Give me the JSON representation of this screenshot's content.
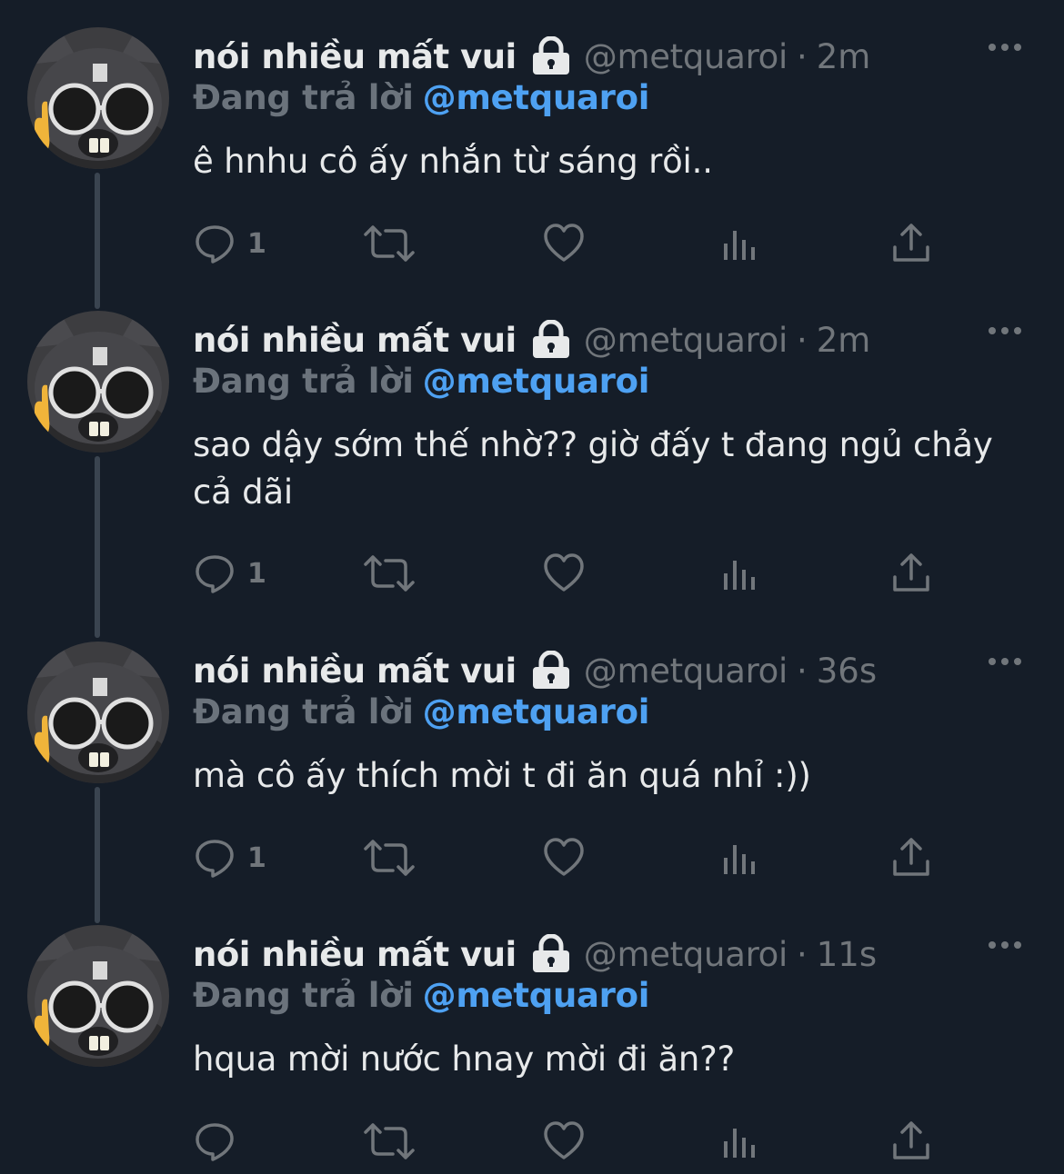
{
  "colors": {
    "background": "#151d28",
    "text_primary": "#e7e9ea",
    "text_secondary": "#71767b",
    "mention": "#4ea1f2",
    "thread_line": "#3a4450"
  },
  "tweets": [
    {
      "name": "nói nhiều mất vui",
      "handle": "@metquaroi",
      "dot": "·",
      "time": "2m",
      "replying_label": "Đang trả lời",
      "replying_to": "@metquaroi",
      "text": "ê hnhu cô ấy nhắn từ sáng rồi..",
      "reply_count": "1",
      "icons": [
        "lock-icon",
        "more-icon",
        "reply-icon",
        "retweet-icon",
        "like-icon",
        "views-icon",
        "share-icon"
      ]
    },
    {
      "name": "nói nhiều mất vui",
      "handle": "@metquaroi",
      "dot": "·",
      "time": "2m",
      "replying_label": "Đang trả lời",
      "replying_to": "@metquaroi",
      "text": "sao dậy sớm thế nhờ?? giờ đấy t đang ngủ chảy cả dãi",
      "reply_count": "1",
      "icons": [
        "lock-icon",
        "more-icon",
        "reply-icon",
        "retweet-icon",
        "like-icon",
        "views-icon",
        "share-icon"
      ]
    },
    {
      "name": "nói nhiều mất vui",
      "handle": "@metquaroi",
      "dot": "·",
      "time": "36s",
      "replying_label": "Đang trả lời",
      "replying_to": "@metquaroi",
      "text": "mà cô ấy thích mời t đi ăn quá nhỉ :))",
      "reply_count": "1",
      "icons": [
        "lock-icon",
        "more-icon",
        "reply-icon",
        "retweet-icon",
        "like-icon",
        "views-icon",
        "share-icon"
      ]
    },
    {
      "name": "nói nhiều mất vui",
      "handle": "@metquaroi",
      "dot": "·",
      "time": "11s",
      "replying_label": "Đang trả lời",
      "replying_to": "@metquaroi",
      "text": "hqua mời nước hnay mời đi ăn??",
      "reply_count": "",
      "icons": [
        "lock-icon",
        "more-icon",
        "reply-icon",
        "retweet-icon",
        "like-icon",
        "views-icon",
        "share-icon"
      ]
    }
  ]
}
